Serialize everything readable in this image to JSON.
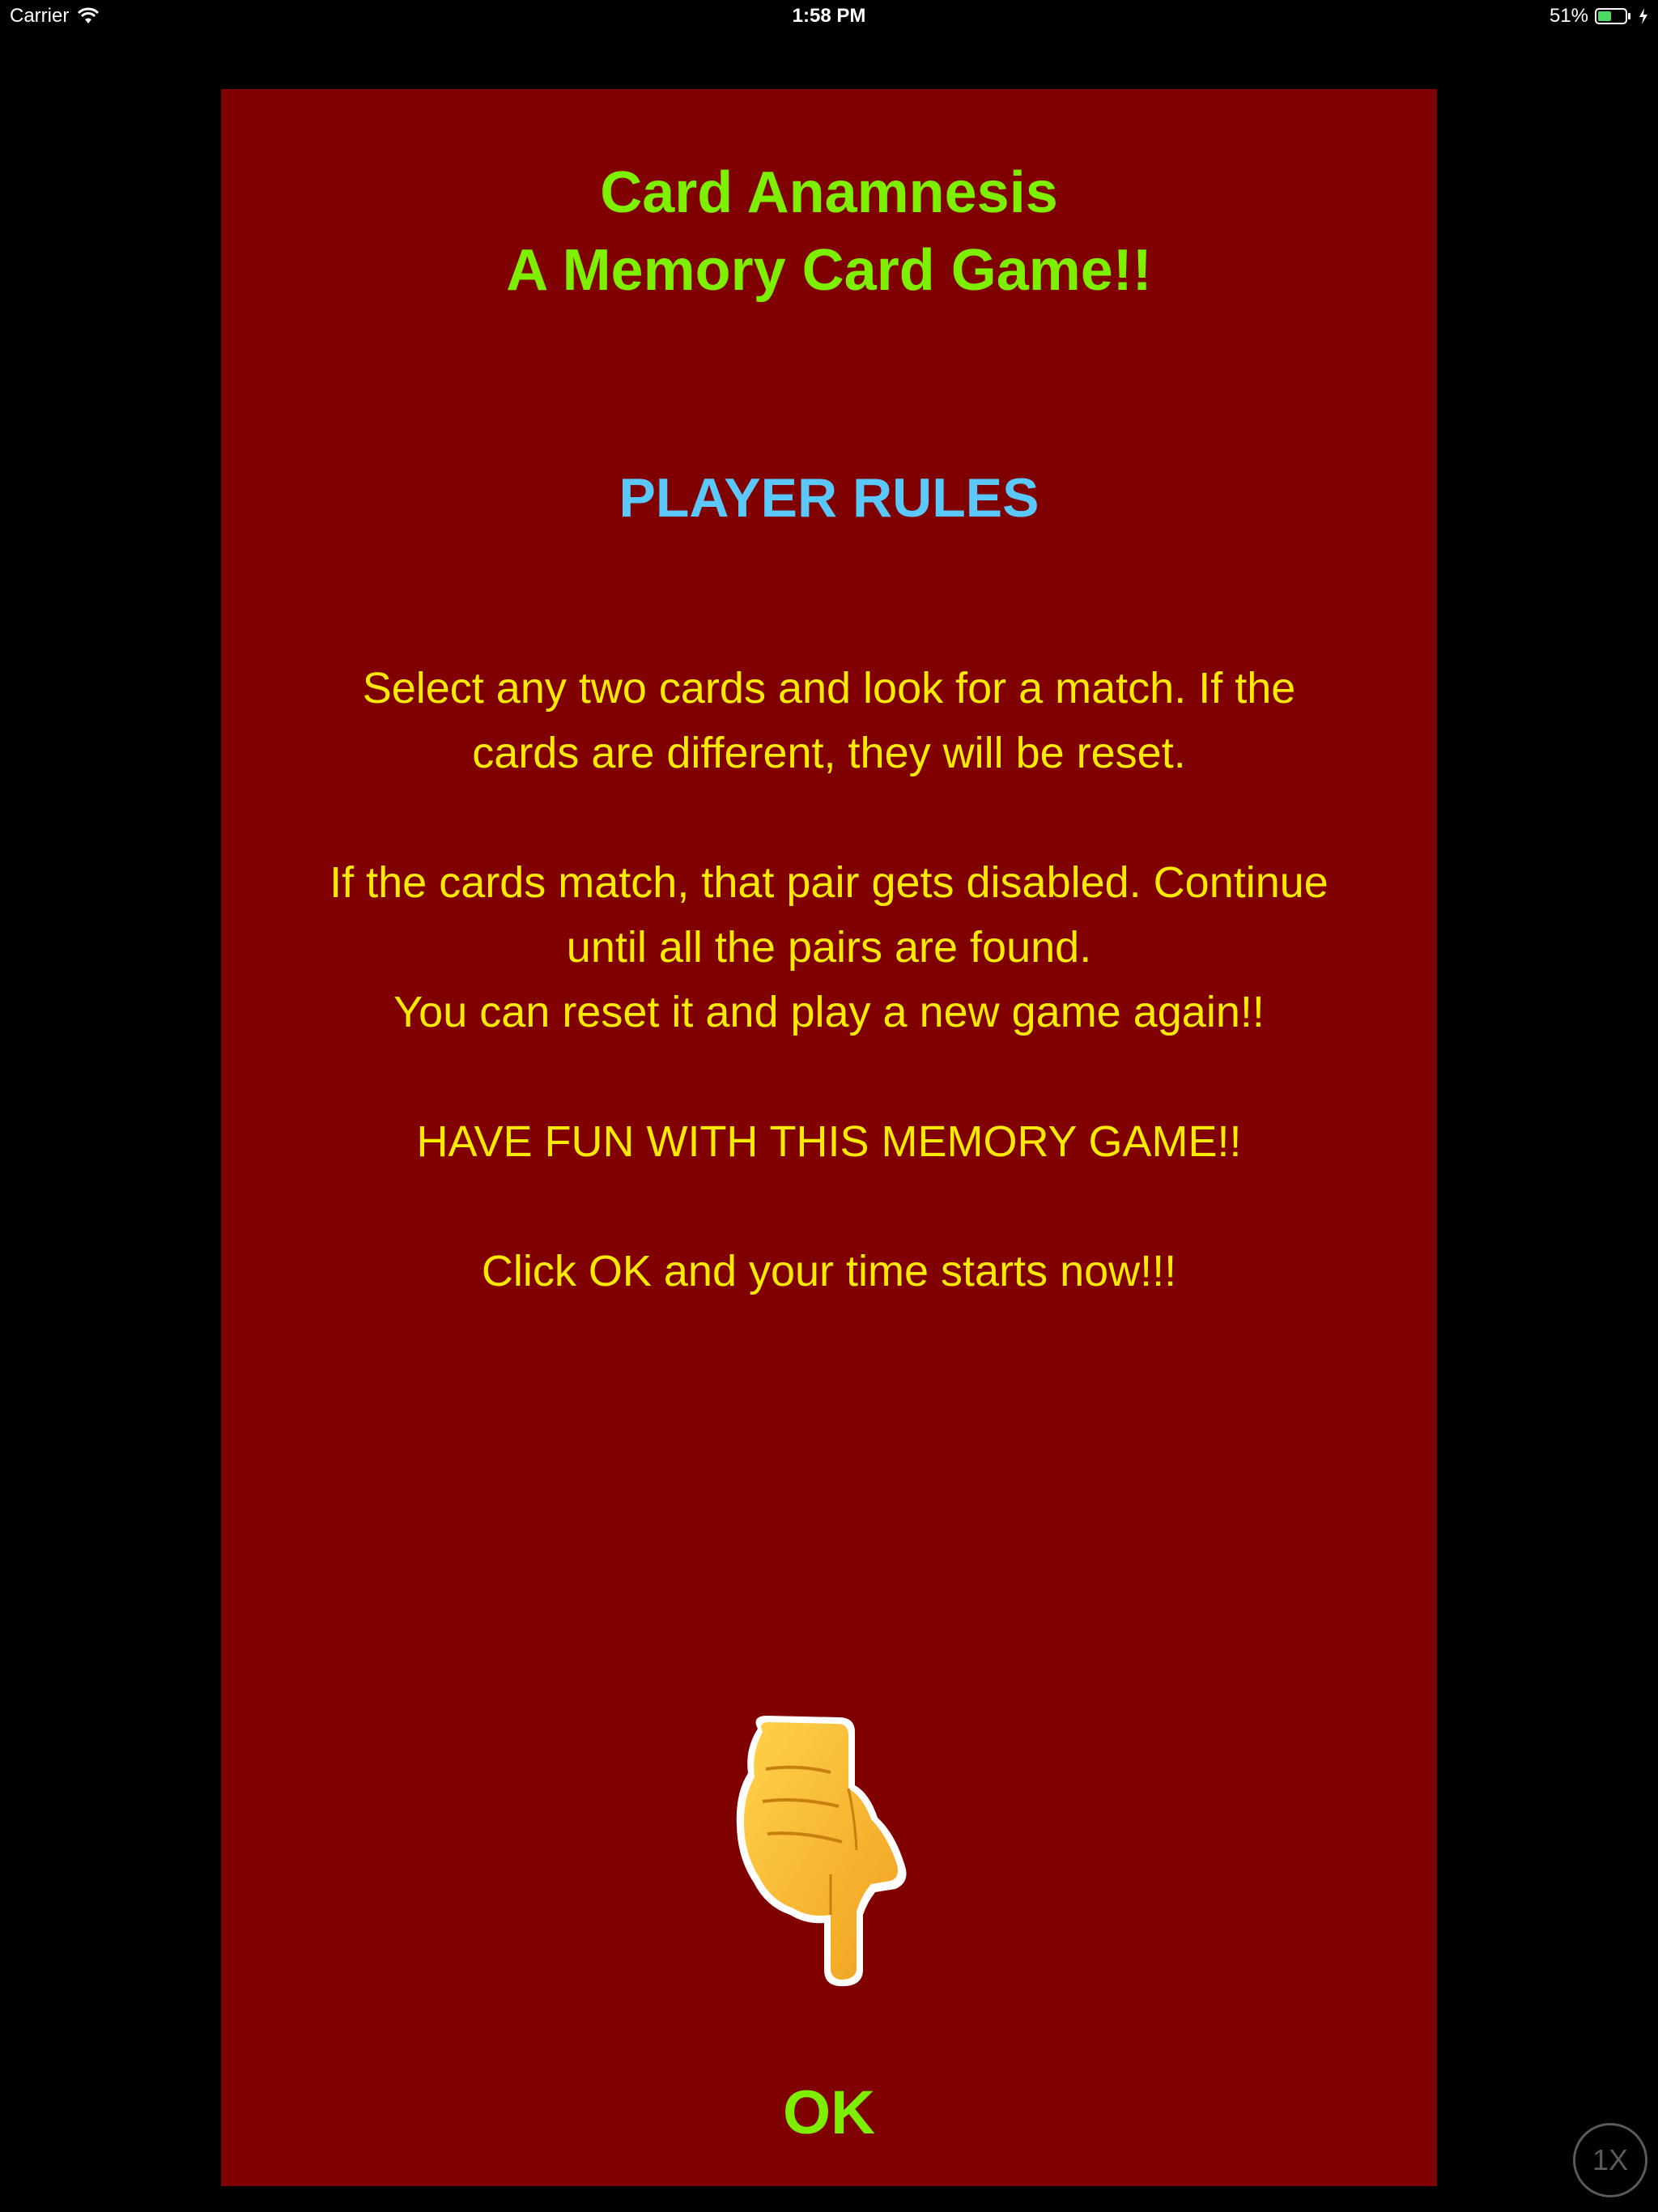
{
  "status_bar": {
    "carrier": "Carrier",
    "time": "1:58 PM",
    "battery": "51%",
    "battery_level": 0.51,
    "icons": [
      "wifi-icon",
      "battery-icon",
      "charging-bolt-icon"
    ]
  },
  "panel": {
    "title_line1": "Card Anamnesis",
    "title_line2": "A Memory Card Game!!",
    "rules_heading": "PLAYER RULES",
    "rules": {
      "p1_line1": "Select any two cards and look for a match. If the",
      "p1_line2": "cards are different, they will be reset.",
      "p2_line1": "If the cards match, that pair gets disabled.  Continue",
      "p2_line2": "until all the pairs are found.",
      "p2_line3": "You can reset it and play a new game again!!",
      "p3": "HAVE FUN WITH THIS MEMORY GAME!!",
      "p4": "Click OK and your time starts now!!!"
    },
    "pointer_icon": "pointing-down-hand-icon",
    "ok_label": "OK"
  },
  "zoom_badge": "1X",
  "colors": {
    "background": "#000000",
    "panel": "#800000",
    "title": "#7cf000",
    "heading": "#5ac8fa",
    "body_text": "#ffea00",
    "ok": "#7cf000"
  }
}
